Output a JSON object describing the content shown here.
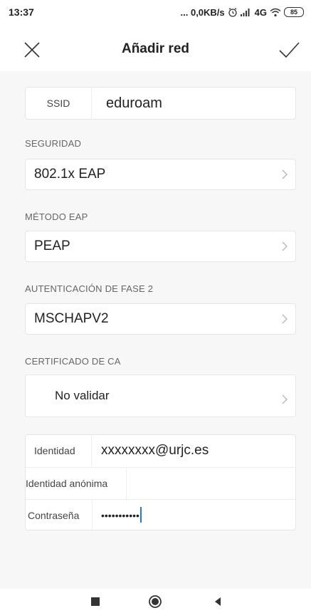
{
  "status_bar": {
    "time": "13:37",
    "network_speed": "... 0,0KB/s",
    "network_type": "4G",
    "battery": "85"
  },
  "header": {
    "title": "Añadir red",
    "close_icon": "close-icon",
    "confirm_icon": "checkmark-icon"
  },
  "ssid": {
    "label": "SSID",
    "value": "eduroam"
  },
  "security": {
    "label": "SEGURIDAD",
    "value": "802.1x EAP"
  },
  "eap_method": {
    "label": "MÉTODO EAP",
    "value": "PEAP"
  },
  "phase2": {
    "label": "AUTENTICACIÓN DE FASE 2",
    "value": "MSCHAPV2"
  },
  "ca_cert": {
    "label": "CERTIFICADO DE CA",
    "value": "No validar"
  },
  "identity": {
    "label": "Identidad",
    "value": "xxxxxxxx@urjc.es"
  },
  "anonymous_identity": {
    "label": "Identidad anónima",
    "value": ""
  },
  "password": {
    "label": "Contraseña",
    "value": "•••••••••••"
  },
  "navbar": {
    "recents_icon": "square-icon",
    "home_icon": "circle-icon",
    "back_icon": "triangle-back-icon"
  },
  "colors": {
    "background": "#f7f7f7",
    "card": "#ffffff",
    "cursor": "#1f7ae0"
  }
}
